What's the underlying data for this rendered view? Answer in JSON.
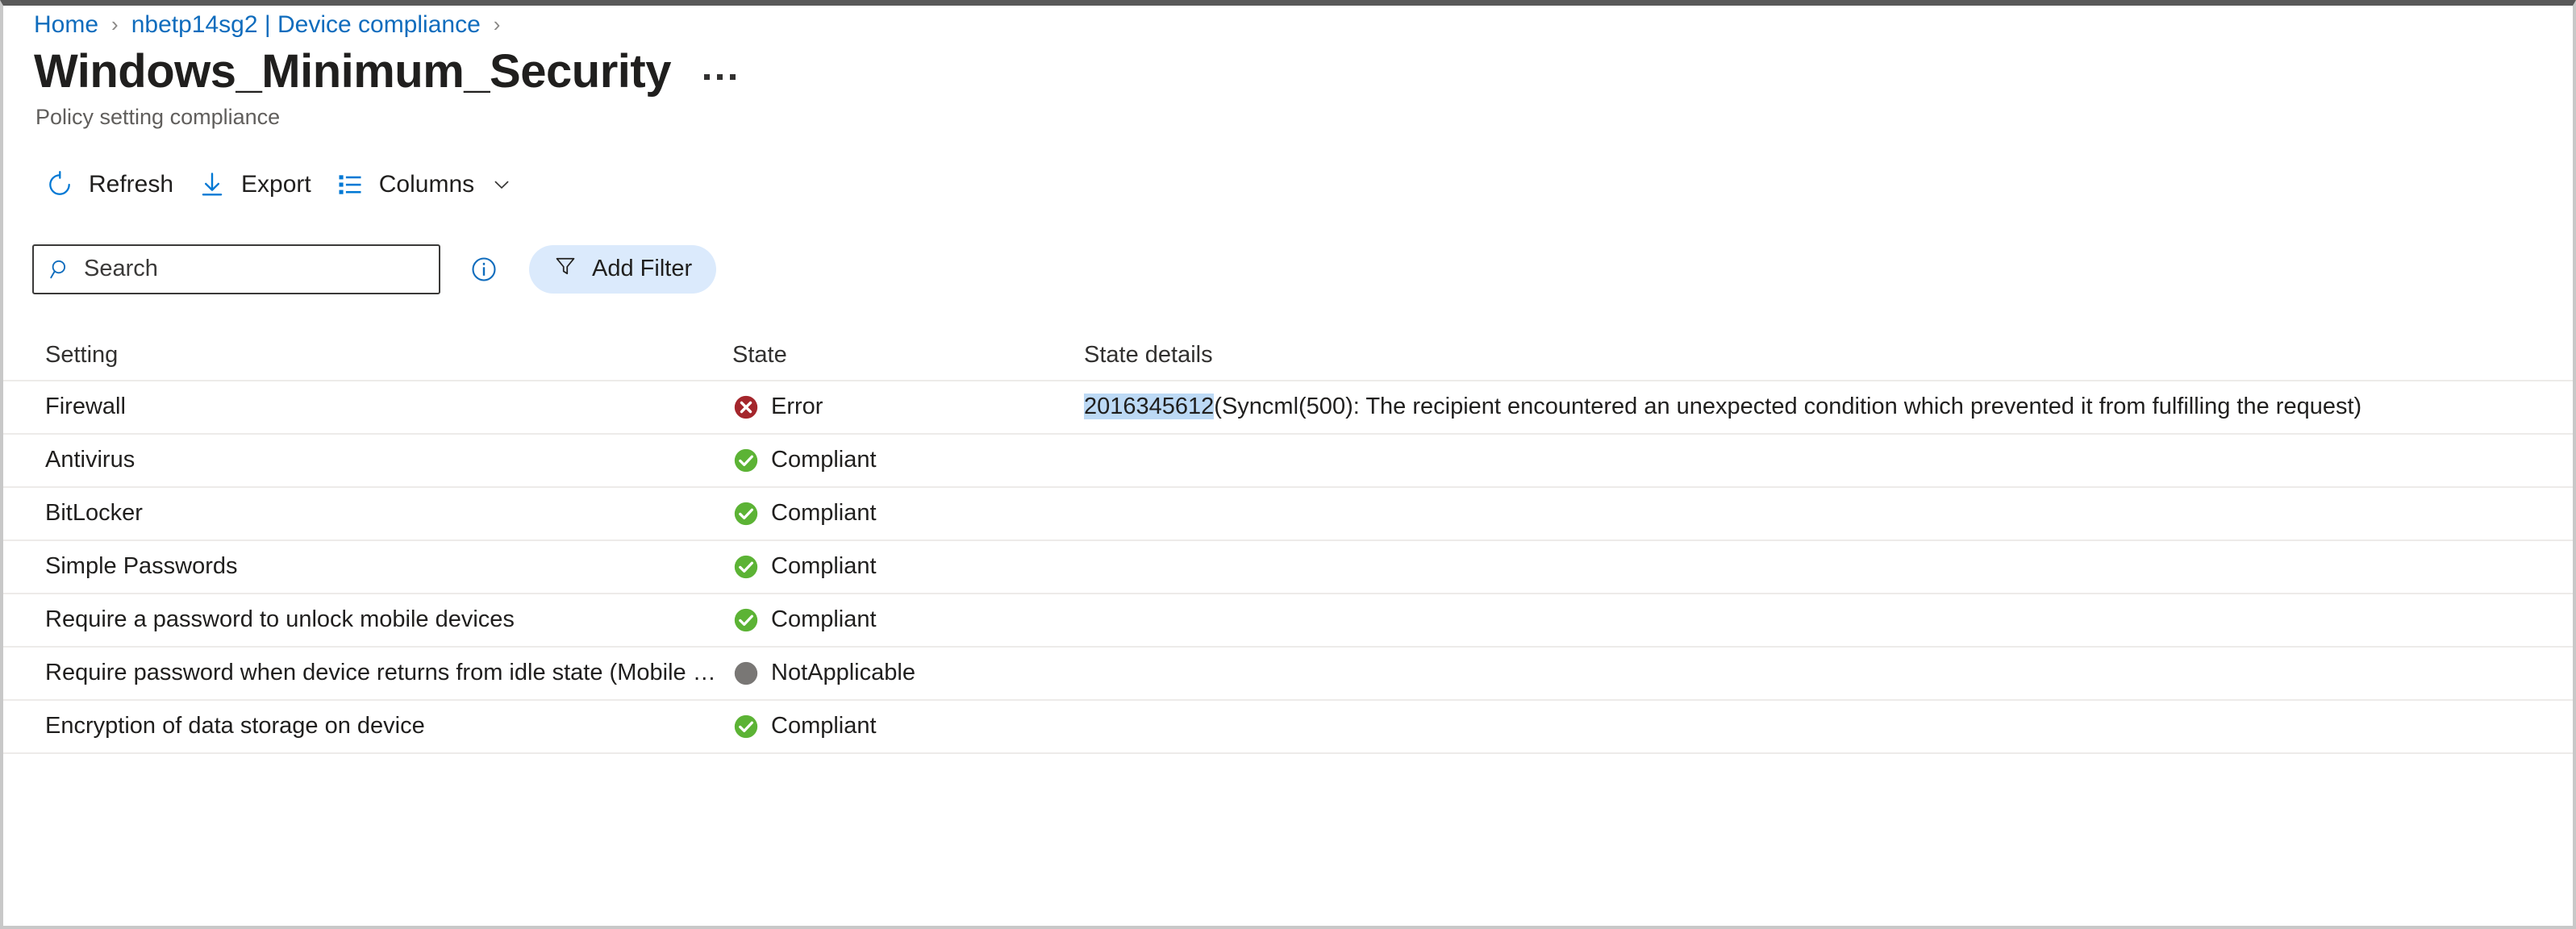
{
  "breadcrumb": {
    "items": [
      {
        "label": "Home",
        "type": "link"
      },
      {
        "label": "nbetp14sg2 | Device compliance",
        "type": "link"
      }
    ],
    "separator": "›"
  },
  "header": {
    "title": "Windows_Minimum_Security",
    "subtitle": "Policy setting compliance",
    "more_options_label": "More options"
  },
  "toolbar": {
    "refresh_label": "Refresh",
    "export_label": "Export",
    "columns_label": "Columns"
  },
  "search": {
    "placeholder": "Search",
    "value": "",
    "info_tooltip": "i",
    "add_filter_label": "Add Filter"
  },
  "table": {
    "columns": [
      "Setting",
      "State",
      "State details"
    ],
    "rows": [
      {
        "setting": "Firewall",
        "state": "Error",
        "state_icon": "error-icon",
        "details_highlight": "2016345612",
        "details_rest": "(Syncml(500): The recipient encountered an unexpected condition which prevented it from fulfilling the request)"
      },
      {
        "setting": "Antivirus",
        "state": "Compliant",
        "state_icon": "compliant-icon",
        "details_highlight": "",
        "details_rest": ""
      },
      {
        "setting": "BitLocker",
        "state": "Compliant",
        "state_icon": "compliant-icon",
        "details_highlight": "",
        "details_rest": ""
      },
      {
        "setting": "Simple Passwords",
        "state": "Compliant",
        "state_icon": "compliant-icon",
        "details_highlight": "",
        "details_rest": ""
      },
      {
        "setting": "Require a password to unlock mobile devices",
        "state": "Compliant",
        "state_icon": "compliant-icon",
        "details_highlight": "",
        "details_rest": ""
      },
      {
        "setting": "Require password when device returns from idle state (Mobile …",
        "state": "NotApplicable",
        "state_icon": "notapplicable-icon",
        "details_highlight": "",
        "details_rest": ""
      },
      {
        "setting": "Encryption of data storage on device",
        "state": "Compliant",
        "state_icon": "compliant-icon",
        "details_highlight": "",
        "details_rest": ""
      }
    ]
  },
  "colors": {
    "link": "#0f6cbd",
    "accent": "#0078d4",
    "error": "#a4262c",
    "compliant": "#5cb335",
    "notapplicable": "#797775",
    "highlight": "#bcd9f5",
    "row_divider": "#edebe9"
  }
}
